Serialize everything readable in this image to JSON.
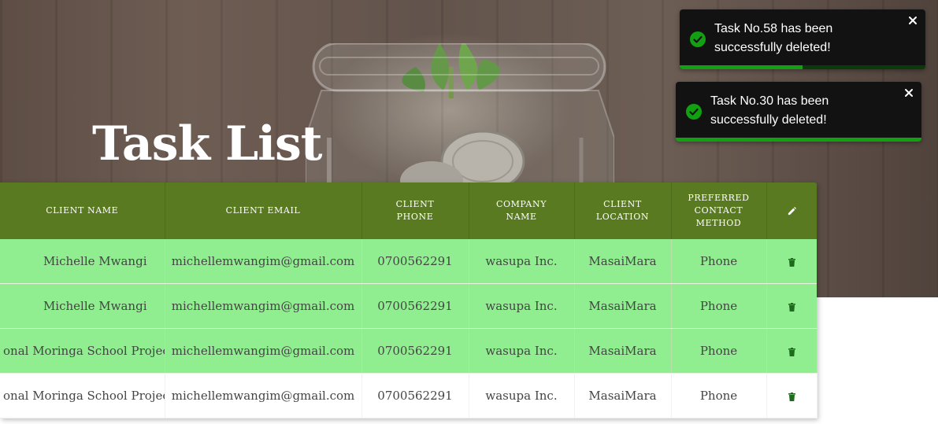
{
  "page": {
    "title": "Task List"
  },
  "toasts": [
    {
      "message_line1": "Task No.58 has been",
      "message_line2": "successfully deleted!",
      "progress": 0.5,
      "icon": "check-circle-icon",
      "status_color": "#12a012"
    },
    {
      "message_line1": "Task No.30 has been",
      "message_line2": "successfully deleted!",
      "progress": 1.0,
      "icon": "check-circle-icon",
      "status_color": "#12a012"
    }
  ],
  "table": {
    "headers": {
      "client_name": "CLIENT NAME",
      "client_email": "CLIENT EMAIL",
      "client_phone_1": "CLIENT",
      "client_phone_2": "PHONE",
      "company_name_1": "COMPANY",
      "company_name_2": "NAME",
      "client_location_1": "CLIENT",
      "client_location_2": "LOCATION",
      "preferred_1": "PREFERRED",
      "preferred_2": "CONTACT",
      "preferred_3": "METHOD",
      "actions_icon": "pencil-icon"
    },
    "rows": [
      {
        "name": "Michelle Mwangi",
        "email": "michellemwangim@gmail.com",
        "phone": "0700562291",
        "company": "wasupa Inc.",
        "location": "MasaiMara",
        "contact": "Phone",
        "action_icon": "trash-icon"
      },
      {
        "name": "Michelle Mwangi",
        "email": "michellemwangim@gmail.com",
        "phone": "0700562291",
        "company": "wasupa Inc.",
        "location": "MasaiMara",
        "contact": "Phone",
        "action_icon": "trash-icon"
      },
      {
        "name": "onal Moringa School Project",
        "email": "michellemwangim@gmail.com",
        "phone": "0700562291",
        "company": "wasupa Inc.",
        "location": "MasaiMara",
        "contact": "Phone",
        "action_icon": "trash-icon"
      },
      {
        "name": "onal Moringa School Project",
        "email": "michellemwangim@gmail.com",
        "phone": "0700562291",
        "company": "wasupa Inc.",
        "location": "MasaiMara",
        "contact": "Phone",
        "action_icon": "trash-icon"
      }
    ]
  },
  "colors": {
    "header_bg": "#5a7a22",
    "row_highlight": "#90ee90",
    "icon_green": "#1e6b1e",
    "toast_bg": "#121212"
  }
}
